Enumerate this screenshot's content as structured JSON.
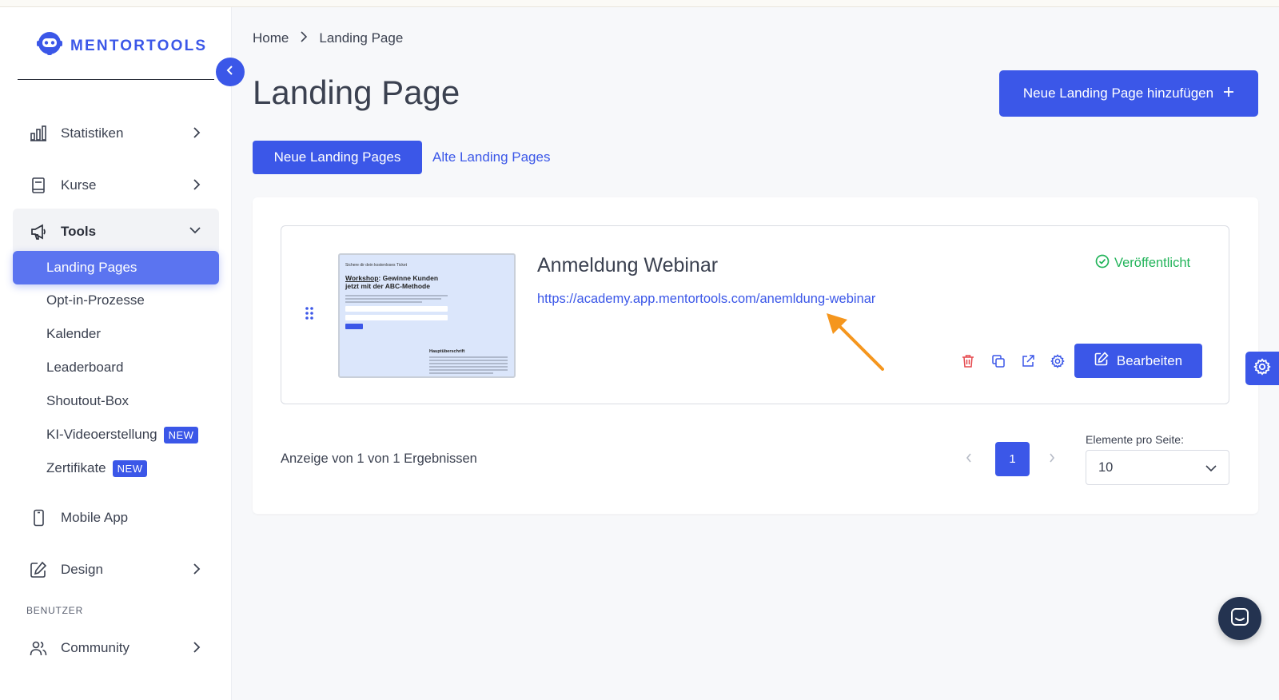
{
  "brand": {
    "name": "MENTORTOOLS",
    "color": "#3b57e8"
  },
  "sidebar": {
    "items": [
      {
        "label": "Statistiken",
        "icon": "bar-chart-icon"
      },
      {
        "label": "Kurse",
        "icon": "book-icon"
      },
      {
        "label": "Tools",
        "icon": "megaphone-icon",
        "expanded": true
      },
      {
        "label": "Mobile App",
        "icon": "smartphone-icon"
      },
      {
        "label": "Design",
        "icon": "pencil-square-icon"
      }
    ],
    "tools_sub": [
      {
        "label": "Landing Pages",
        "active": true
      },
      {
        "label": "Opt-in-Prozesse"
      },
      {
        "label": "Kalender"
      },
      {
        "label": "Leaderboard"
      },
      {
        "label": "Shoutout-Box"
      },
      {
        "label": "KI-Videoerstellung",
        "badge": "NEW"
      },
      {
        "label": "Zertifikate",
        "badge": "NEW"
      }
    ],
    "section_benutzer": "BENUTZER",
    "community": {
      "label": "Community",
      "icon": "users-icon"
    }
  },
  "breadcrumb": {
    "home": "Home",
    "current": "Landing Page"
  },
  "page": {
    "title": "Landing Page",
    "add_button": "Neue Landing Page hinzufügen",
    "tabs": {
      "new": "Neue Landing Pages",
      "old": "Alte Landing Pages"
    }
  },
  "landing_pages": [
    {
      "title": "Anmeldung Webinar",
      "url": "https://academy.app.mentortools.com/anemldung-webinar",
      "status": "Veröffentlicht",
      "edit_label": "Bearbeiten",
      "thumbnail": {
        "line1": "Sichere dir dein kostenloses Ticket",
        "headline_underlined": "Workshop",
        "headline_rest": ": Gewinne Kunden jetzt mit der ABC-Methode",
        "subheading": "Hauptüberschrift"
      }
    }
  ],
  "pagination": {
    "summary": "Anzeige von 1 von 1 Ergebnissen",
    "current_page": "1",
    "per_page_label": "Elemente pro Seite:",
    "per_page_value": "10"
  },
  "colors": {
    "primary": "#3b57e8",
    "success": "#22b45a",
    "danger": "#e5484d",
    "annotation_arrow": "#f5961d"
  }
}
